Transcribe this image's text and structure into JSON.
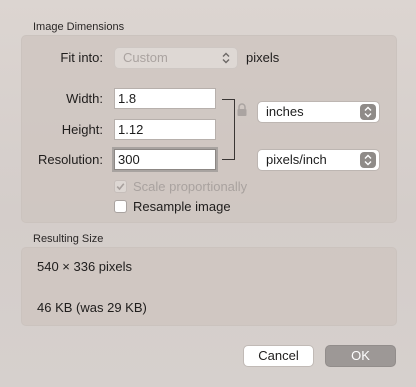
{
  "dimensions": {
    "section_title": "Image Dimensions",
    "fit_into": {
      "label": "Fit into:",
      "value": "Custom",
      "suffix": "pixels"
    },
    "width": {
      "label": "Width:",
      "value": "1.8"
    },
    "height": {
      "label": "Height:",
      "value": "1.12"
    },
    "resolution": {
      "label": "Resolution:",
      "value": "300"
    },
    "size_unit": "inches",
    "resolution_unit": "pixels/inch",
    "scale_proportionally": {
      "label": "Scale proportionally",
      "checked": true,
      "enabled": false
    },
    "resample_image": {
      "label": "Resample image",
      "checked": false
    }
  },
  "result": {
    "section_title": "Resulting Size",
    "pixels": "540 × 336 pixels",
    "file_size": "46 KB (was 29 KB)"
  },
  "buttons": {
    "cancel_label": "Cancel",
    "ok_label": "OK"
  },
  "colors": {
    "window_background": "#d7d0cc",
    "group_background": "#cdc4bf",
    "ok_button": "#9d9896"
  },
  "icons": {
    "lock": "lock-icon",
    "popup_arrows": "up-down-chevron-icon",
    "checkmark": "checkmark-icon"
  }
}
